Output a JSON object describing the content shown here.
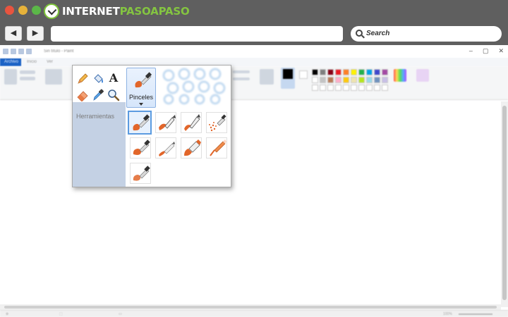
{
  "browser": {
    "logo": {
      "part1": "INTERNET",
      "part2": "PASOAPASO"
    },
    "nav": {
      "back_glyph": "◀",
      "forward_glyph": "▶"
    },
    "search": {
      "placeholder": "Search"
    }
  },
  "paint": {
    "title": "Sin título - Paint",
    "window_controls": [
      "–",
      "▢",
      "✕"
    ],
    "tabs": [
      "Archivo",
      "Inicio",
      "Ver"
    ],
    "statusbar": {
      "zoom": "100%"
    }
  },
  "popup": {
    "tools_label": "Herramientas",
    "tool_icons": [
      "pencil-icon",
      "fill-bucket-icon",
      "text-icon",
      "eraser-icon",
      "color-picker-icon",
      "magnifier-icon"
    ],
    "text_tool_glyph": "A",
    "brushes_label": "Pinceles",
    "brush_options": [
      {
        "icon": "brush-icon",
        "selected": true
      },
      {
        "icon": "calligraphy-brush-icon",
        "selected": false
      },
      {
        "icon": "calligraphy-brush-2-icon",
        "selected": false
      },
      {
        "icon": "airbrush-icon",
        "selected": false
      },
      {
        "icon": "oil-brush-icon",
        "selected": false
      },
      {
        "icon": "crayon-icon",
        "selected": false
      },
      {
        "icon": "marker-icon",
        "selected": false
      },
      {
        "icon": "natural-pencil-icon",
        "selected": false
      },
      {
        "icon": "watercolor-brush-icon",
        "selected": false
      }
    ]
  },
  "colors": {
    "accent_orange": "#e2662a",
    "selection_blue": "#5b9be0",
    "file_tab_blue": "#1b62c5",
    "logo_green": "#84c441"
  }
}
